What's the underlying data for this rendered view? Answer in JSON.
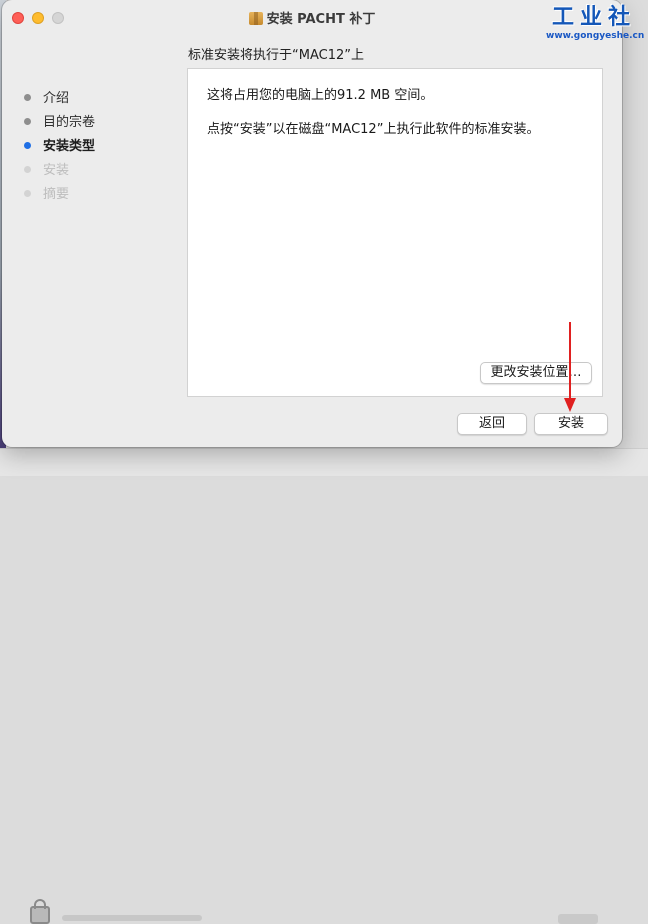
{
  "window": {
    "title": "安装 PACHT 补丁",
    "subtitle": "标准安装将执行于“MAC12”上"
  },
  "sidebar": {
    "steps": [
      {
        "label": "介绍",
        "state": "done"
      },
      {
        "label": "目的宗卷",
        "state": "done"
      },
      {
        "label": "安装类型",
        "state": "current"
      },
      {
        "label": "安装",
        "state": "pending"
      },
      {
        "label": "摘要",
        "state": "pending"
      }
    ]
  },
  "content": {
    "line1": "这将占用您的电脑上的91.2 MB 空间。",
    "line2": "点按“安装”以在磁盘“MAC12”上执行此软件的标准安装。"
  },
  "buttons": {
    "change_location": "更改安装位置…",
    "back": "返回",
    "install": "安装"
  },
  "watermark": {
    "main": "工业社",
    "url": "www.gongyeshe.cn"
  },
  "colors": {
    "accent": "#1f6fe5",
    "annotation_arrow": "#e02020",
    "watermark": "#1457b8"
  }
}
